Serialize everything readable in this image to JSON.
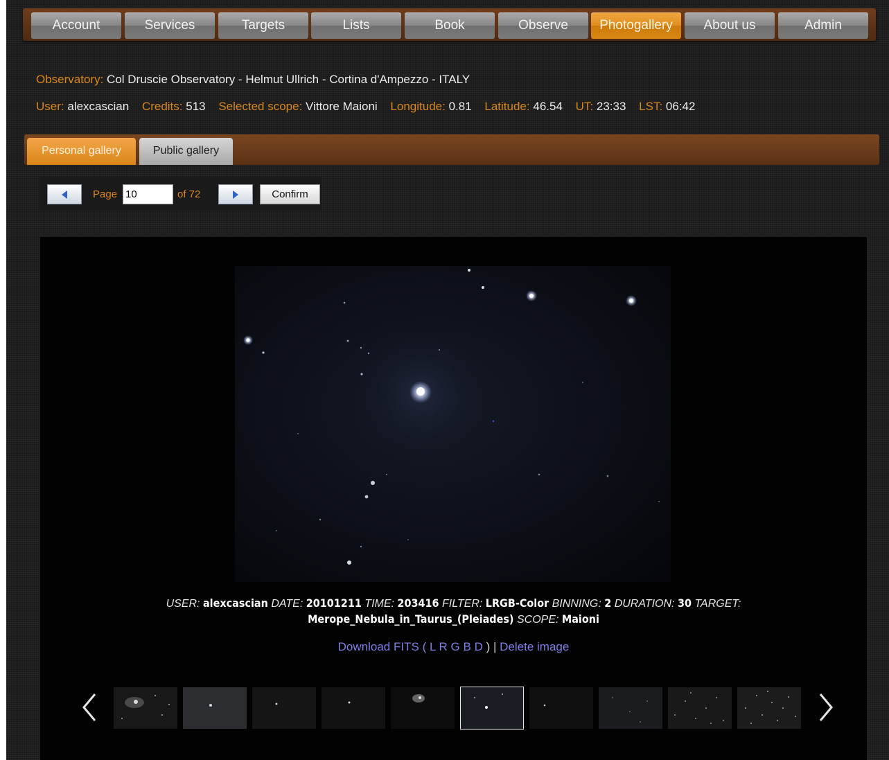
{
  "nav": {
    "items": [
      {
        "label": "Account"
      },
      {
        "label": "Services"
      },
      {
        "label": "Targets"
      },
      {
        "label": "Lists"
      },
      {
        "label": "Book"
      },
      {
        "label": "Observe"
      },
      {
        "label": "Photogallery",
        "active": true
      },
      {
        "label": "About us"
      },
      {
        "label": "Admin"
      }
    ]
  },
  "info": {
    "observatory_label": "Observatory:",
    "observatory_value": "Col Druscie Observatory - Helmut Ullrich - Cortina d'Ampezzo - ITALY",
    "user_label": "User:",
    "user_value": "alexcascian",
    "credits_label": "Credits:",
    "credits_value": "513",
    "scope_label": "Selected scope:",
    "scope_value": "Vittore Maioni",
    "longitude_label": "Longitude:",
    "longitude_value": "0.81",
    "latitude_label": "Latitude:",
    "latitude_value": "46.54",
    "ut_label": "UT:",
    "ut_value": "23:33",
    "lst_label": "LST:",
    "lst_value": "06:42"
  },
  "tabs": {
    "personal": "Personal gallery",
    "public": "Public gallery"
  },
  "pager": {
    "page_label": "Page",
    "page_value": "10",
    "of_label": "of 72",
    "confirm_label": "Confirm"
  },
  "caption": {
    "user_label": "USER:",
    "user": "alexcascian",
    "date_label": "DATE:",
    "date": "20101211",
    "time_label": "TIME:",
    "time": "203416",
    "filter_label": "FILTER:",
    "filter": "LRGB-Color",
    "binning_label": "BINNING:",
    "binning": "2",
    "duration_label": "DURATION:",
    "duration": "30",
    "target_label": "TARGET:",
    "target": "Merope_Nebula_in_Taurus_(Pleiades)",
    "scope_label": "SCOPE:",
    "scope": "Maioni"
  },
  "links": {
    "download": "Download FITS",
    "open_paren": "(",
    "l": "L",
    "r": "R",
    "g": "G",
    "b": "B",
    "d": "D",
    "close_paren_sep": ") |",
    "delete": "Delete image"
  },
  "carousel": {
    "thumb_count": 10,
    "selected_index": 5,
    "prev_icon": "chevron-left-icon",
    "next_icon": "chevron-right-icon"
  },
  "colors": {
    "accent_orange": "#d9871c",
    "link_blue": "#7d7fe6",
    "nav_bar_brown": "#5a3114"
  }
}
